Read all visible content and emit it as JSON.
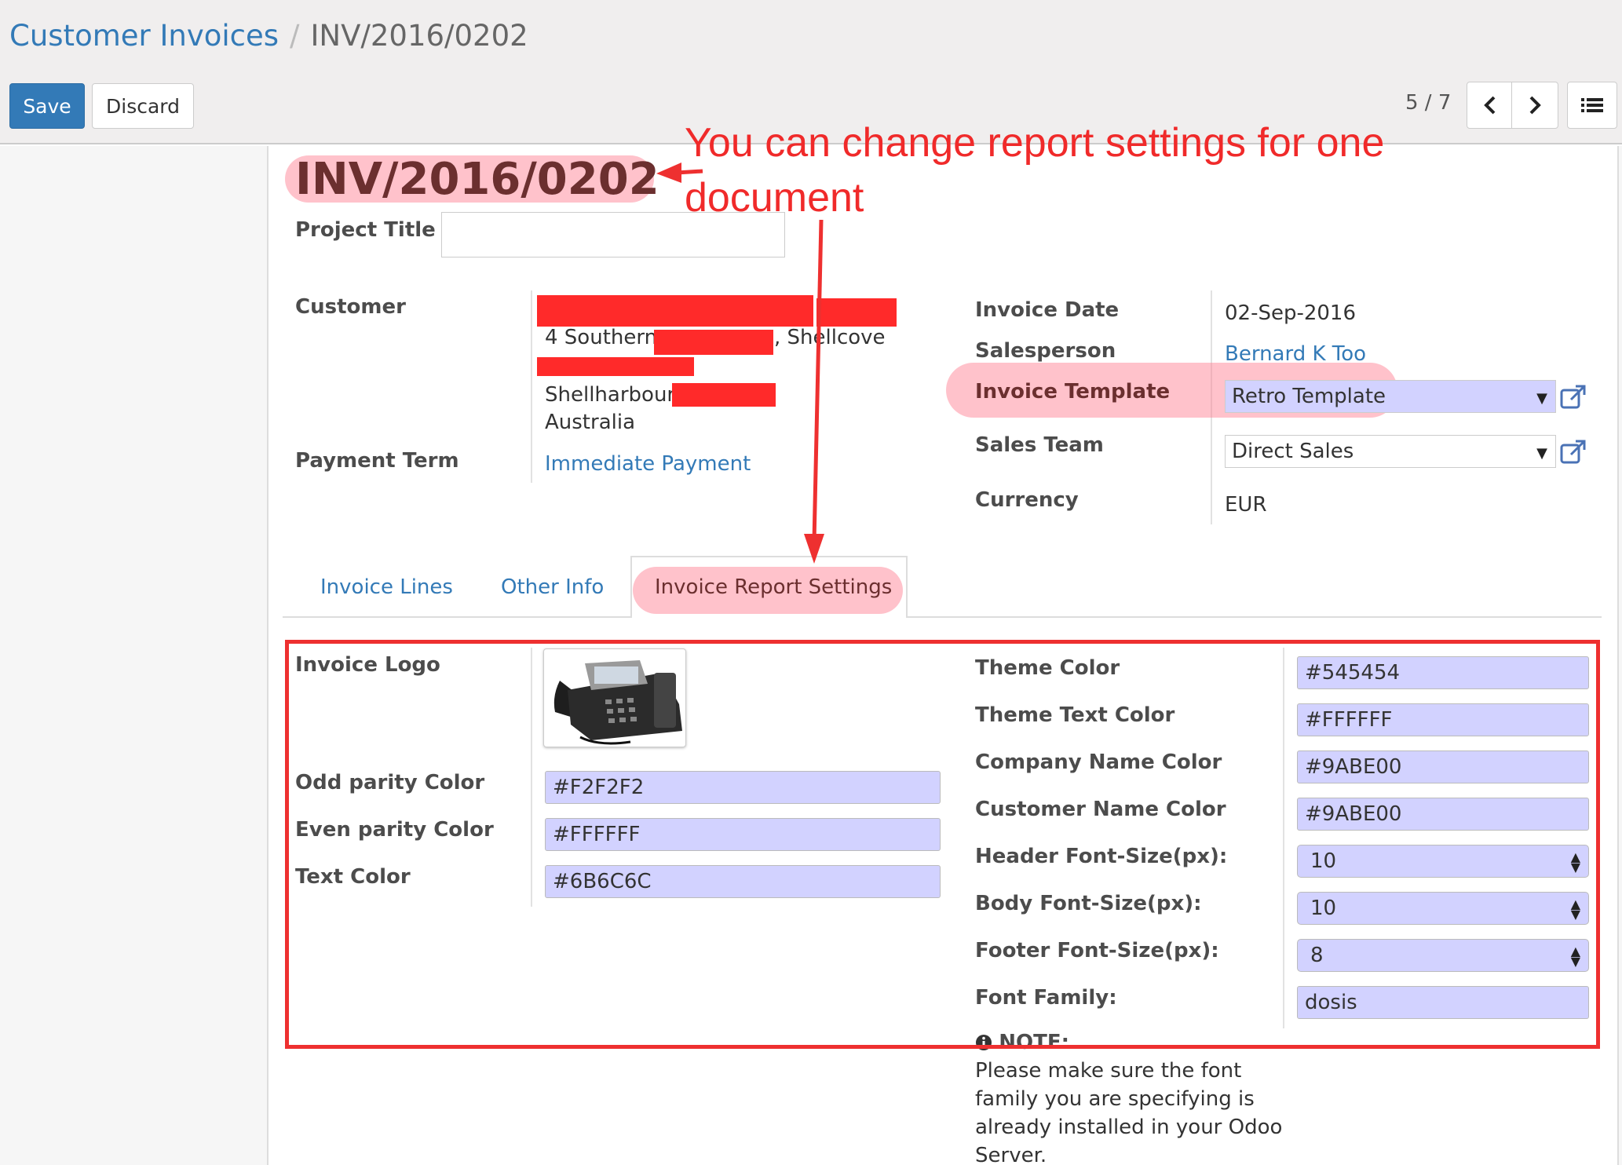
{
  "breadcrumb": {
    "parent": "Customer Invoices",
    "separator": "/",
    "current": "INV/2016/0202"
  },
  "toolbar": {
    "save_label": "Save",
    "discard_label": "Discard"
  },
  "pager": {
    "text": "5 / 7"
  },
  "form": {
    "title": "INV/2016/0202",
    "project_title_label": "Project Title",
    "project_title_value": "",
    "customer_label": "Customer",
    "customer_lines": [
      "4 Southern",
      ", Shellcove",
      "Shellharbour",
      "Australia"
    ],
    "payment_term_label": "Payment Term",
    "payment_term_value": "Immediate Payment",
    "invoice_date_label": "Invoice Date",
    "invoice_date_value": "02-Sep-2016",
    "salesperson_label": "Salesperson",
    "salesperson_value": "Bernard K Too",
    "invoice_template_label": "Invoice Template",
    "invoice_template_value": "Retro Template",
    "sales_team_label": "Sales Team",
    "sales_team_value": "Direct Sales",
    "currency_label": "Currency",
    "currency_value": "EUR"
  },
  "tabs": [
    {
      "label": "Invoice Lines"
    },
    {
      "label": "Other Info"
    },
    {
      "label": "Invoice Report Settings",
      "active": true
    }
  ],
  "report_settings": {
    "invoice_logo_label": "Invoice Logo",
    "left_fields": [
      {
        "label": "Odd parity Color",
        "value": "#F2F2F2"
      },
      {
        "label": "Even parity Color",
        "value": "#FFFFFF"
      },
      {
        "label": "Text Color",
        "value": "#6B6C6C"
      }
    ],
    "right_fields": [
      {
        "label": "Theme Color",
        "value": "#545454"
      },
      {
        "label": "Theme Text Color",
        "value": "#FFFFFF"
      },
      {
        "label": "Company Name Color",
        "value": "#9ABE00"
      },
      {
        "label": "Customer Name Color",
        "value": "#9ABE00"
      },
      {
        "label": "Header Font-Size(px):",
        "value": "10"
      },
      {
        "label": "Body Font-Size(px):",
        "value": "10"
      },
      {
        "label": "Footer Font-Size(px):",
        "value": "8"
      },
      {
        "label": "Font Family:",
        "value": "dosis"
      }
    ],
    "note_title": "NOTE:",
    "note_text": "Please make sure the font family you are specifying is already installed in your Odoo Server."
  },
  "annotation": {
    "line1": "You can change report settings for one",
    "line2": "document"
  },
  "colors": {
    "primary": "#337ab7",
    "annotation_red": "#ee3030",
    "field_bg": "#d2d2ff"
  }
}
